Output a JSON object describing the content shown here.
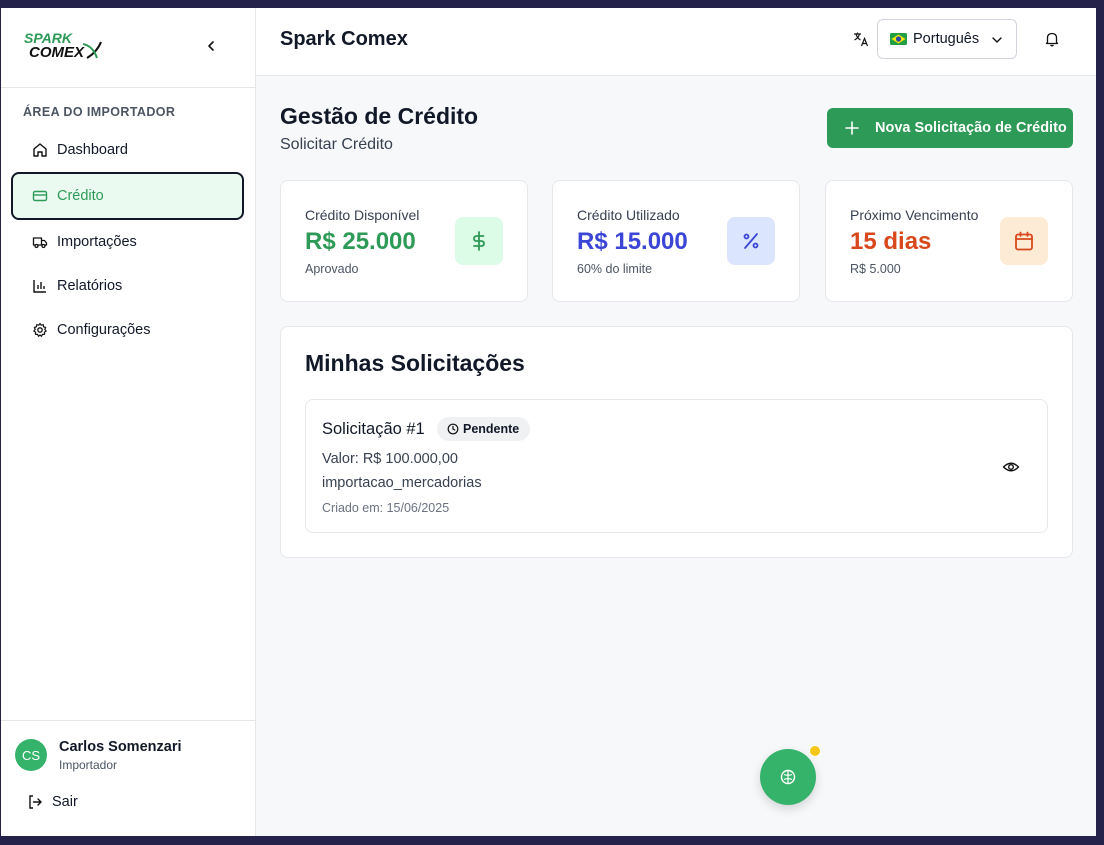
{
  "logo": {
    "line1": "SPARK",
    "line2": "COMEX"
  },
  "sidebar": {
    "section_label": "ÁREA DO IMPORTADOR",
    "items": [
      {
        "label": "Dashboard",
        "icon": "home-icon"
      },
      {
        "label": "Crédito",
        "icon": "credit-card-icon",
        "active": true
      },
      {
        "label": "Importações",
        "icon": "truck-icon"
      },
      {
        "label": "Relatórios",
        "icon": "bar-chart-icon"
      },
      {
        "label": "Configurações",
        "icon": "gear-icon"
      }
    ],
    "user": {
      "initials": "CS",
      "name": "Carlos Somenzari",
      "role": "Importador"
    },
    "logout_label": "Sair"
  },
  "header": {
    "title": "Spark Comex",
    "language": {
      "selected": "Português",
      "flag": "brazil-flag"
    }
  },
  "page": {
    "title": "Gestão de Crédito",
    "subtitle": "Solicitar Crédito",
    "new_request_label": "Nova Solicitação de Crédito"
  },
  "stats": [
    {
      "label": "Crédito Disponível",
      "value": "R$ 25.000",
      "sub": "Aprovado",
      "icon": "dollar-icon",
      "color": "#2e9a57",
      "icon_bg": "#dcfce7"
    },
    {
      "label": "Crédito Utilizado",
      "value": "R$ 15.000",
      "sub": "60% do limite",
      "icon": "percent-icon",
      "color": "#3b46d6",
      "icon_bg": "#dbe5fd"
    },
    {
      "label": "Próximo Vencimento",
      "value": "15 dias",
      "sub": "R$ 5.000",
      "icon": "calendar-icon",
      "color": "#d9481c",
      "icon_bg": "#fdebd6"
    }
  ],
  "requests_panel": {
    "title": "Minhas Solicitações",
    "items": [
      {
        "title": "Solicitação #1",
        "status": "Pendente",
        "value": "Valor: R$ 100.000,00",
        "type": "importacao_mercadorias",
        "created": "Criado em: 15/06/2025"
      }
    ]
  },
  "colors": {
    "brand": "#2e9a57",
    "fab": "#36b36b",
    "notification_dot": "#f5c518"
  }
}
